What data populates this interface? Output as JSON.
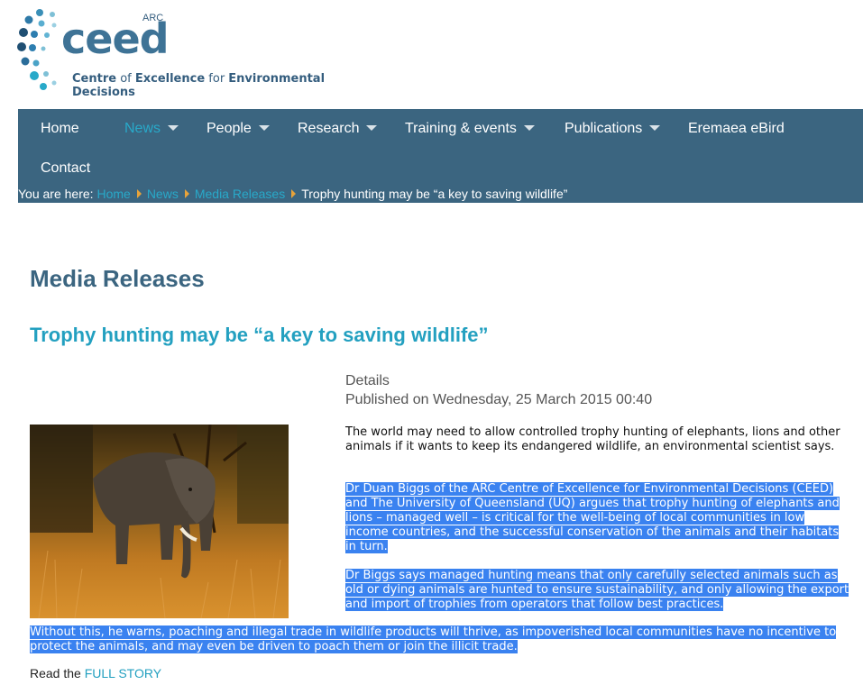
{
  "logo": {
    "arc": "ARC",
    "name": "ceed",
    "tagline_pre": "Centre",
    "tagline_of": " of ",
    "tagline_mid": "Excellence",
    "tagline_for": " for ",
    "tagline_end": "Environmental Decisions"
  },
  "nav": {
    "items": [
      {
        "label": "Home",
        "dropdown": false
      },
      {
        "label": "News",
        "dropdown": true,
        "active": true
      },
      {
        "label": "People",
        "dropdown": true
      },
      {
        "label": "Research",
        "dropdown": true
      },
      {
        "label": "Training & events",
        "dropdown": true
      },
      {
        "label": "Publications",
        "dropdown": true
      },
      {
        "label": "Eremaea eBird",
        "dropdown": false
      },
      {
        "label": "Contact",
        "dropdown": false
      }
    ]
  },
  "breadcrumb": {
    "prefix": "You are here:",
    "home": "Home",
    "news": "News",
    "media": "Media Releases",
    "current": "Trophy hunting may be “a key to saving wildlife”"
  },
  "page_title": "Media Releases",
  "article": {
    "title": "Trophy hunting may be “a key to saving wildlife”",
    "details_label": "Details",
    "published": "Published on Wednesday, 25 March 2015 00:40",
    "p1": "The world may need to allow controlled trophy hunting of elephants, lions and other animals if it wants to keep its endangered wildlife, an environmental scientist says.",
    "p2": "Dr Duan Biggs of the ARC Centre of Excellence for Environmental Decisions (CEED) and The University of Queensland (UQ) argues that trophy hunting of elephants and lions – managed well – is critical for the well-being of local communities in low income countries, and the successful conservation of the animals and their habitats in turn.",
    "p3": "Dr Biggs says managed hunting means that only carefully selected animals such as old or dying animals are hunted to ensure sustainability, and only allowing the export and import of trophies from operators that follow best practices.",
    "p4": "Without this, he warns, poaching and illegal trade in wildlife products will thrive, as impoverished local communities have no incentive to protect the animals, and may even be driven to poach them or join the illicit trade.",
    "read_prefix": "Read the",
    "read_link": "FULL STORY"
  },
  "colors": {
    "nav_bg": "#3b6580",
    "accent": "#23a0c0",
    "selection": "#3a82f0",
    "breadcrumb_arrow": "#e8a33a"
  }
}
